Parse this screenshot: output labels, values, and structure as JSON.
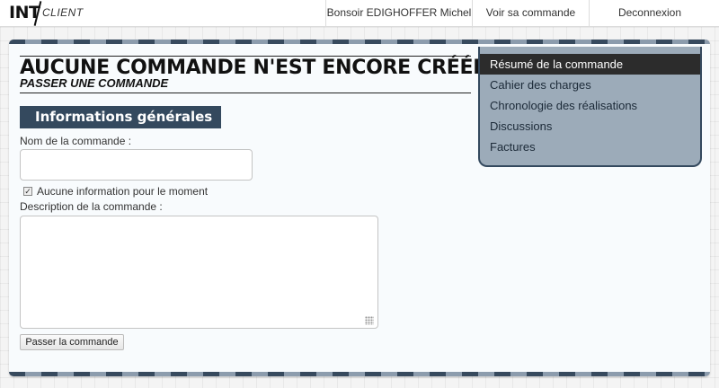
{
  "logo": {
    "primary": "INT",
    "secondary": "CLIENT"
  },
  "nav": {
    "greeting": "Bonsoir EDIGHOFFER Michel",
    "view_order": "Voir sa commande",
    "logout": "Deconnexion"
  },
  "page": {
    "title": "AUCUNE COMMANDE N'EST ENCORE CRÉÉE",
    "subtitle": "PASSER UNE COMMANDE"
  },
  "form": {
    "section_title": "Informations générales",
    "name_label": "Nom de la commande :",
    "name_value": "",
    "no_info_checked": true,
    "no_info_label": "Aucune information pour le moment",
    "description_label": "Description de la commande :",
    "description_value": "",
    "submit_label": "Passer la commande"
  },
  "side_menu": {
    "items": [
      {
        "label": "Résumé de la commande",
        "active": true
      },
      {
        "label": "Cahier des charges",
        "active": false
      },
      {
        "label": "Chronologie des réalisations",
        "active": false
      },
      {
        "label": "Discussions",
        "active": false
      },
      {
        "label": "Factures",
        "active": false
      }
    ]
  },
  "colors": {
    "accent": "#34495e",
    "menu_bg": "#9cabb9",
    "active_item": "#2c2c2c"
  }
}
